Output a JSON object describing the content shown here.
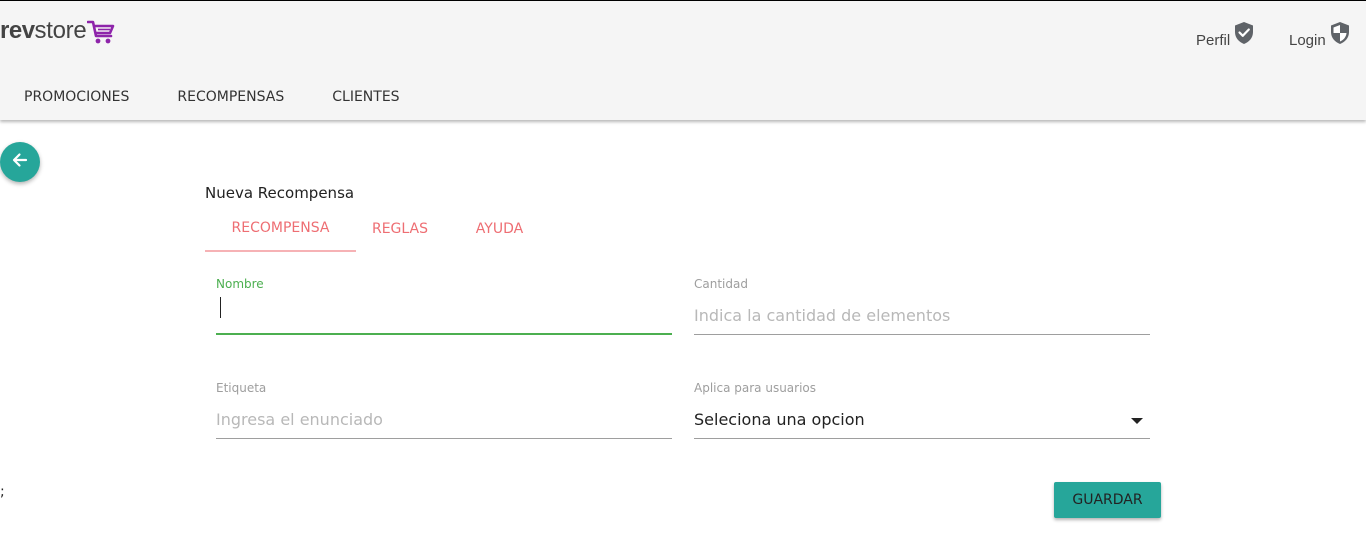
{
  "brand": {
    "name_bold": "rev",
    "name_regular": "store",
    "cart_icon": "shopping-cart-icon",
    "color": "#444444",
    "cart_color": "#8e24aa"
  },
  "user_links": [
    {
      "label": "Perfil",
      "icon": "shield-check-icon"
    },
    {
      "label": "Login",
      "icon": "shield-half-icon"
    }
  ],
  "nav": {
    "items": [
      "PROMOCIONES",
      "RECOMPENSAS",
      "CLIENTES"
    ]
  },
  "back_button": {
    "icon": "arrow-left-icon",
    "color": "#26a69a"
  },
  "form": {
    "title": "Nueva Recompensa",
    "tabs": [
      {
        "label": "RECOMPENSA",
        "active": true
      },
      {
        "label": "REGLAS",
        "active": false
      },
      {
        "label": "AYUDA",
        "active": false
      }
    ],
    "fields": {
      "nombre": {
        "label": "Nombre",
        "value": "",
        "placeholder": ""
      },
      "cantidad": {
        "label": "Cantidad",
        "value": "",
        "placeholder": "Indica la cantidad de elementos"
      },
      "etiqueta": {
        "label": "Etiqueta",
        "value": "",
        "placeholder": "Ingresa el enunciado"
      },
      "aplica": {
        "label": "Aplica para usuarios",
        "selected": "Seleciona una opcion"
      }
    },
    "save_label": "GUARDAR"
  },
  "stray_text": ";",
  "colors": {
    "accent": "#26a69a",
    "tab": "#ee6e73",
    "focus": "#4caf50"
  }
}
